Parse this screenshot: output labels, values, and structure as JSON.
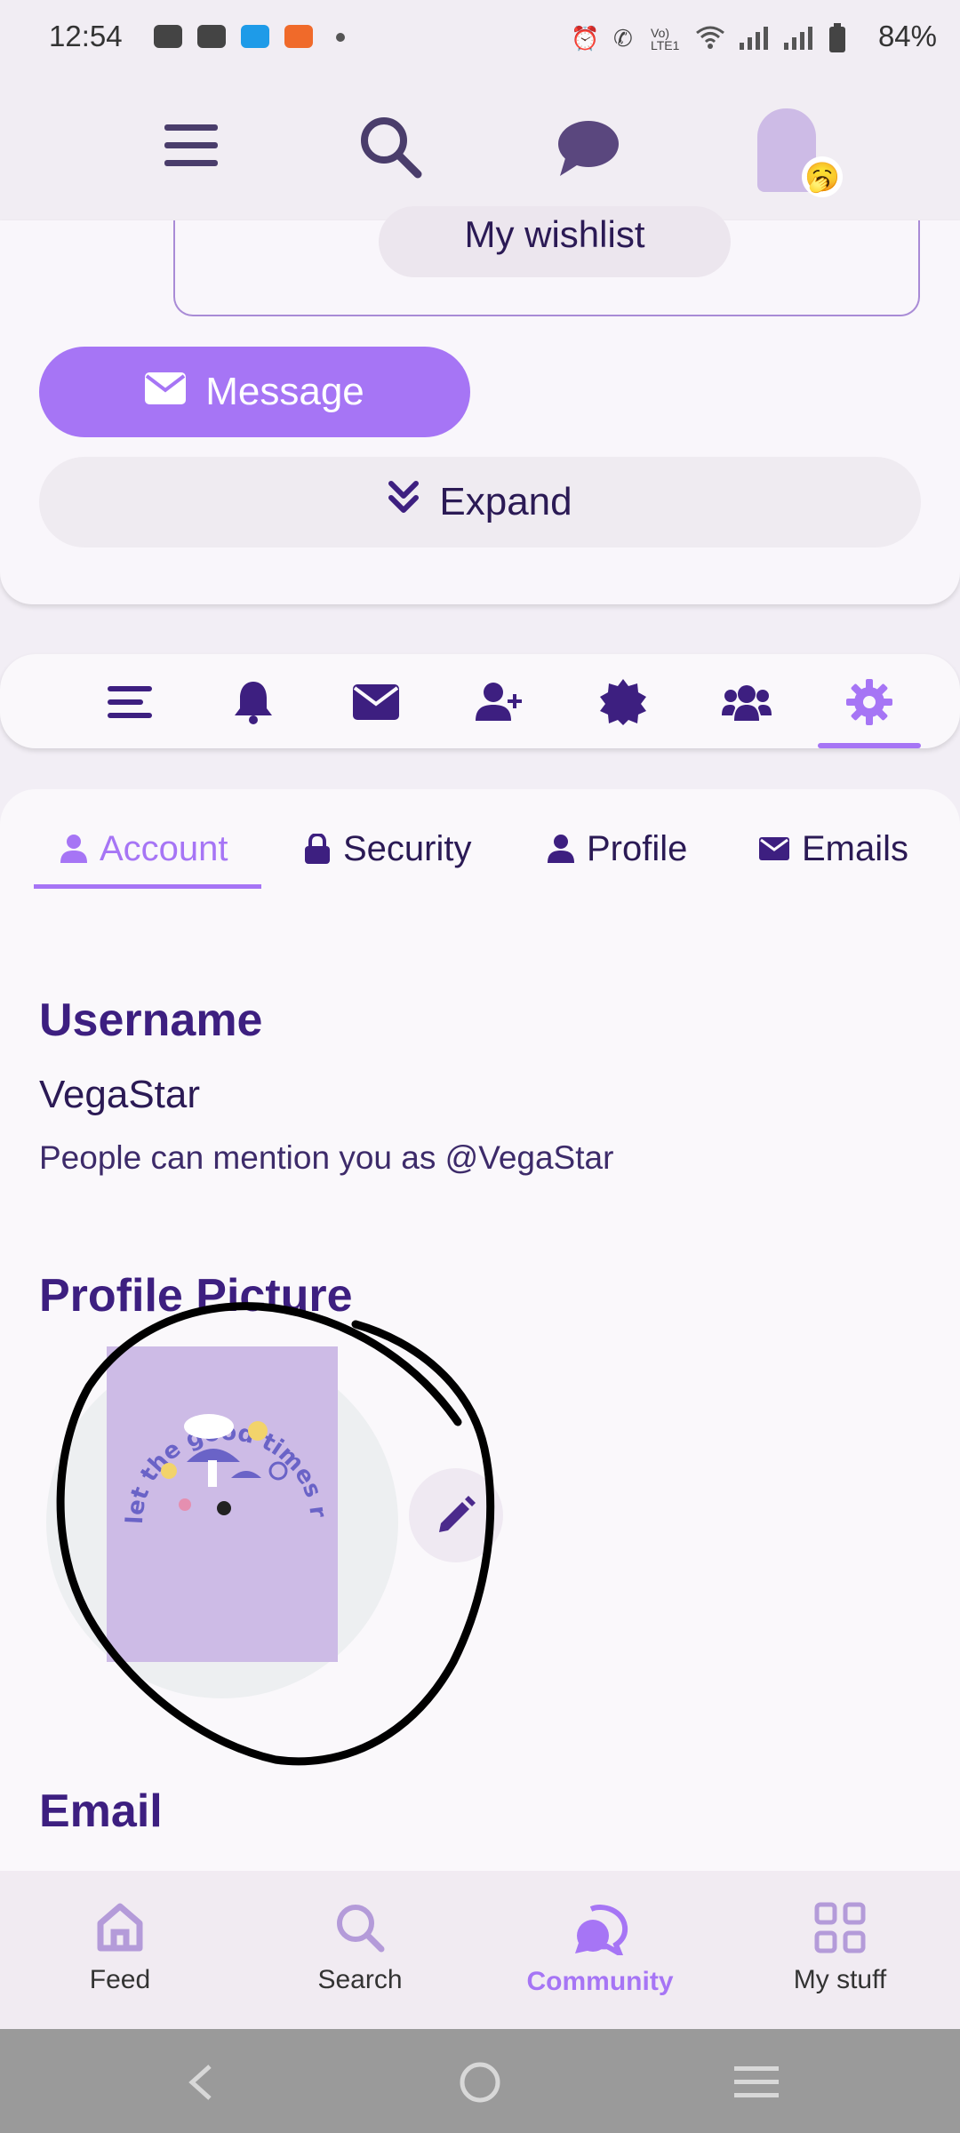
{
  "status_bar": {
    "time": "12:54",
    "battery": "84%",
    "network_label": "Vo) LTE1"
  },
  "top_bar": {
    "menu_icon": "hamburger-icon",
    "search_icon": "search-icon",
    "chat_icon": "chat-bubble-icon",
    "avatar_emoji": "🥱"
  },
  "card": {
    "wishlist_label": "My wishlist",
    "message_label": "Message",
    "expand_label": "Expand"
  },
  "icon_tabs": [
    "list-icon",
    "bell-icon",
    "envelope-icon",
    "add-user-icon",
    "badge-icon",
    "users-icon",
    "gear-icon"
  ],
  "settings_tabs": [
    {
      "label": "Account",
      "icon": "user-icon",
      "active": true
    },
    {
      "label": "Security",
      "icon": "lock-icon",
      "active": false
    },
    {
      "label": "Profile",
      "icon": "user-icon",
      "active": false
    },
    {
      "label": "Emails",
      "icon": "envelope-icon",
      "active": false
    }
  ],
  "account": {
    "username_title": "Username",
    "username": "VegaStar",
    "mention_text": "People can mention you as @VegaStar",
    "profile_picture_title": "Profile Picture",
    "avatar_text": "let the good times roll",
    "email_title": "Email"
  },
  "bottom_nav": [
    {
      "label": "Feed",
      "icon": "home-icon"
    },
    {
      "label": "Search",
      "icon": "search-icon"
    },
    {
      "label": "Community",
      "icon": "community-icon",
      "active": true
    },
    {
      "label": "My stuff",
      "icon": "grid-icon"
    }
  ],
  "colors": {
    "accent": "#a675f5",
    "title": "#3d1f80",
    "text": "#2b1a55"
  }
}
